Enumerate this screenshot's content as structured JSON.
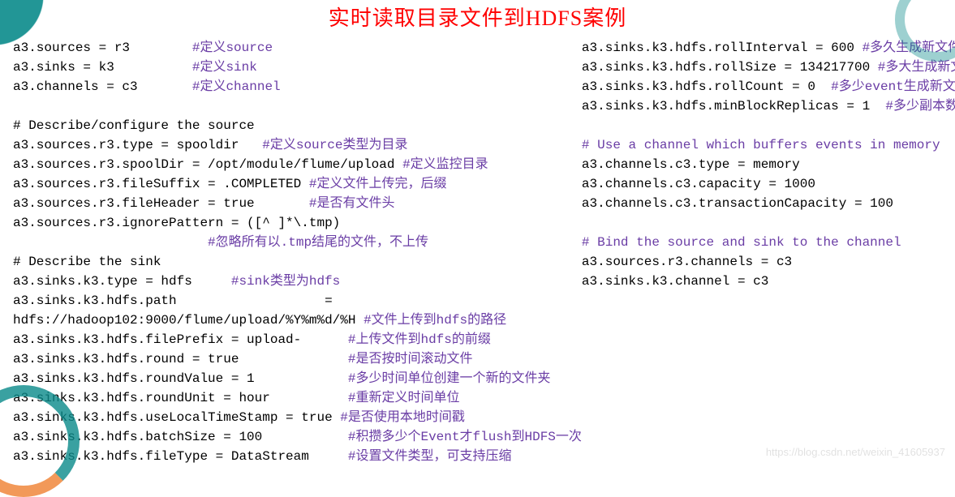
{
  "title": "实时读取目录文件到HDFS案例",
  "watermark": "https://blog.csdn.net/weixin_41605937",
  "left": {
    "l01a": "a3.sources = r3        ",
    "l01c": "#定义source",
    "l02a": "a3.sinks = k3          ",
    "l02c": "#定义sink",
    "l03a": "a3.channels = c3       ",
    "l03c": "#定义channel",
    "l04": "",
    "l05": "# Describe/configure the source",
    "l06a": "a3.sources.r3.type = spooldir   ",
    "l06c": "#定义source类型为目录",
    "l07a": "a3.sources.r3.spoolDir = /opt/module/flume/upload ",
    "l07c": "#定义监控目录",
    "l08a": "a3.sources.r3.fileSuffix = .COMPLETED ",
    "l08c": "#定义文件上传完，后缀",
    "l09a": "a3.sources.r3.fileHeader = true       ",
    "l09c": "#是否有文件头",
    "l10": "a3.sources.r3.ignorePattern = ([^ ]*\\.tmp)",
    "l11c": "                         #忽略所有以.tmp结尾的文件，不上传",
    "l12": "# Describe the sink",
    "l13a": "a3.sinks.k3.type = hdfs     ",
    "l13c": "#sink类型为hdfs",
    "l14": "a3.sinks.k3.hdfs.path                   =",
    "l15a": "hdfs://hadoop102:9000/flume/upload/%Y%m%d/%H ",
    "l15c": "#文件上传到hdfs的路径",
    "l16a": "a3.sinks.k3.hdfs.filePrefix = upload-      ",
    "l16c": "#上传文件到hdfs的前缀",
    "l17a": "a3.sinks.k3.hdfs.round = true              ",
    "l17c": "#是否按时间滚动文件",
    "l18a": "a3.sinks.k3.hdfs.roundValue = 1            ",
    "l18c": "#多少时间单位创建一个新的文件夹",
    "l19a": "a3.sinks.k3.hdfs.roundUnit = hour          ",
    "l19c": "#重新定义时间单位",
    "l20a": "a3.sinks.k3.hdfs.useLocalTimeStamp = true ",
    "l20c": "#是否使用本地时间戳",
    "l21a": "a3.sinks.k3.hdfs.batchSize = 100           ",
    "l21c": "#积攒多少个Event才flush到HDFS一次",
    "l22a": "a3.sinks.k3.hdfs.fileType = DataStream     ",
    "l22c": "#设置文件类型，可支持压缩"
  },
  "right": {
    "r01a": "a3.sinks.k3.hdfs.rollInterval = 600 ",
    "r01c": "#多久生成新文件",
    "r02a": "a3.sinks.k3.hdfs.rollSize = 134217700 ",
    "r02c": "#多大生成新文件",
    "r03a": "a3.sinks.k3.hdfs.rollCount = 0  ",
    "r03c": "#多少event生成新文件",
    "r04a": "a3.sinks.k3.hdfs.minBlockReplicas = 1  ",
    "r04c": "#多少副本数",
    "r05": "",
    "r06c": "# Use a channel which buffers events in memory",
    "r07": "a3.channels.c3.type = memory",
    "r08": "a3.channels.c3.capacity = 1000",
    "r09": "a3.channels.c3.transactionCapacity = 100",
    "r10": "",
    "r11c": "# Bind the source and sink to the channel",
    "r12": "a3.sources.r3.channels = c3",
    "r13": "a3.sinks.k3.channel = c3"
  }
}
